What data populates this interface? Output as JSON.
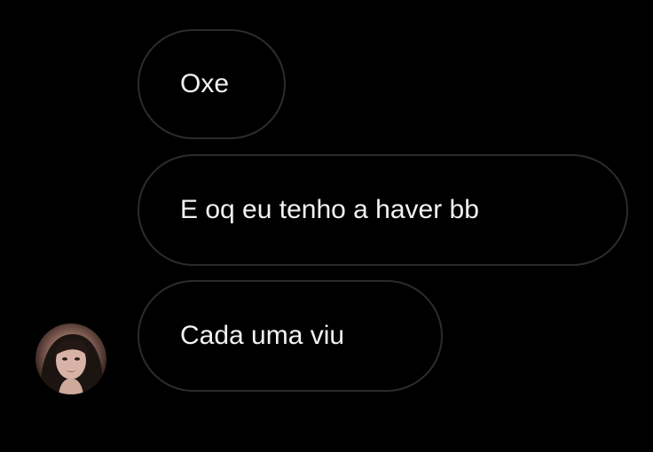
{
  "thread": {
    "messages": [
      {
        "text": "Oxe"
      },
      {
        "text": "E oq eu tenho a haver bb"
      },
      {
        "text": "Cada uma viu"
      }
    ],
    "sender_avatar": {
      "icon": "user-avatar-photo"
    }
  },
  "colors": {
    "background": "#000000",
    "bubble_border": "#2c2c2c",
    "text": "#f2f2f2"
  }
}
